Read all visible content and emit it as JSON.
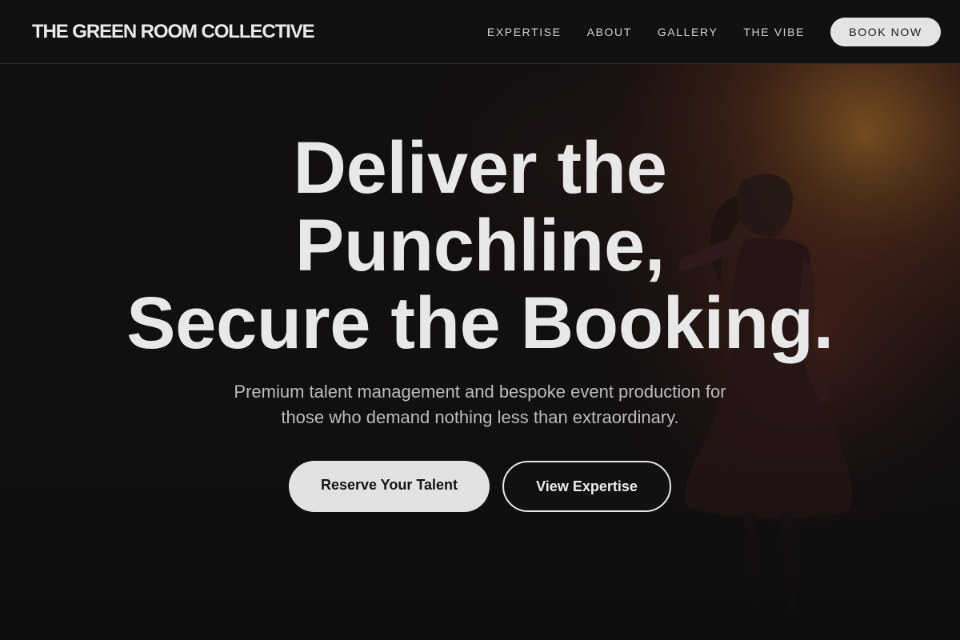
{
  "header": {
    "brand": "THE GREEN ROOM COLLECTIVE",
    "nav": [
      {
        "label": "EXPERTISE"
      },
      {
        "label": "ABOUT"
      },
      {
        "label": "GALLERY"
      },
      {
        "label": "THE VIBE"
      }
    ],
    "book_now_label": "BOOK NOW"
  },
  "hero": {
    "title_lines": [
      "Deliver the",
      "Punchline,",
      "Secure the Booking."
    ],
    "subtitle_lines": [
      "Premium talent management and bespoke event production for",
      "those who demand nothing less than extraordinary."
    ],
    "primary_cta": "Reserve Your Talent",
    "secondary_cta": "View Expertise",
    "background_image": "performer-on-stage-silhouette"
  },
  "colors": {
    "background": "#111010",
    "header_bg": "#111111",
    "text": "#e9e8e8",
    "subtitle": "#bdbbbb",
    "button_light": "#e2e2e2",
    "stage_glow": "#c8782a"
  }
}
